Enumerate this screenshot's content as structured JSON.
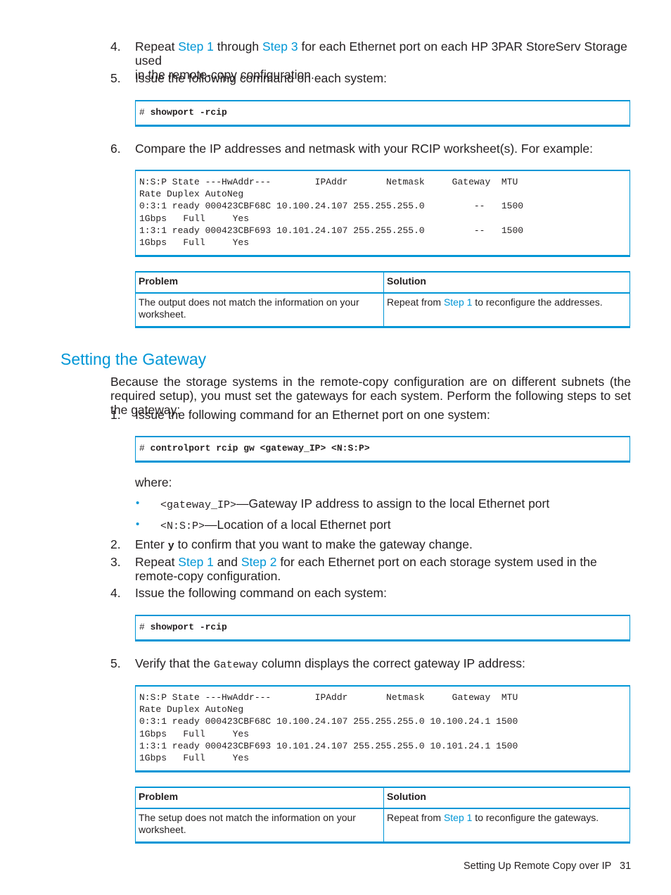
{
  "steps_a": {
    "s4": {
      "num": "4.",
      "t1": "Repeat ",
      "link1": "Step 1",
      "t2": " through ",
      "link2": "Step 3",
      "t3": " for each Ethernet port on each HP 3PAR StoreServ Storage used",
      "line2": "in the remote-copy configuration."
    },
    "s5": {
      "num": "5.",
      "text": "Issue the following command on each system:"
    },
    "cmd1": {
      "prompt": "# ",
      "command": "showport -rcip"
    },
    "s6": {
      "num": "6.",
      "text": "Compare the IP addresses and netmask with your RCIP worksheet(s). For example:"
    },
    "output1": {
      "lines": [
        "N:S:P State ---HwAddr---        IPAddr       Netmask     Gateway  MTU",
        "Rate Duplex AutoNeg",
        "0:3:1 ready 000423CBF68C 10.100.24.107 255.255.255.0         --   1500",
        "1Gbps   Full     Yes",
        "1:3:1 ready 000423CBF693 10.101.24.107 255.255.255.0         --   1500",
        "1Gbps   Full     Yes"
      ]
    },
    "table1": {
      "headers": [
        "Problem",
        "Solution"
      ],
      "problem": "The output does not match the information on your worksheet.",
      "sol_pre": "Repeat from ",
      "sol_link": "Step 1",
      "sol_post": " to reconfigure the addresses."
    }
  },
  "section": {
    "title": "Setting the Gateway",
    "intro": "Because the storage systems in the remote-copy configuration are on different subnets (the required setup), you must set the gateways for each system. Perform the following steps to set the gateway:",
    "s1": {
      "num": "1.",
      "text": "Issue the following command for an Ethernet port on one system:"
    },
    "cmd2": {
      "prompt": "# ",
      "command": "controlport rcip gw <gateway_IP> <N:S:P>"
    },
    "where": "where:",
    "bullets": [
      {
        "code": "<gateway_IP>",
        "text": "—Gateway IP address to assign to the local Ethernet port"
      },
      {
        "code": "<N:S:P>",
        "text": "—Location of a local Ethernet port"
      }
    ],
    "bullet_glyph": "•",
    "s2": {
      "num": "2.",
      "t1": "Enter ",
      "code": "y",
      "t2": " to confirm that you want to make the gateway change."
    },
    "s3": {
      "num": "3.",
      "t1": "Repeat ",
      "link1": "Step 1",
      "t2": " and ",
      "link2": "Step 2",
      "t3": " for each Ethernet port on each storage system used in the",
      "line2": "remote-copy configuration."
    },
    "s4": {
      "num": "4.",
      "text": "Issue the following command on each system:"
    },
    "cmd3": {
      "prompt": "# ",
      "command": "showport -rcip"
    },
    "s5": {
      "num": "5.",
      "t1": "Verify that the ",
      "code": "Gateway",
      "t2": " column displays the correct gateway IP address:"
    },
    "output2": {
      "lines": [
        "N:S:P State ---HwAddr---        IPAddr       Netmask     Gateway  MTU",
        "Rate Duplex AutoNeg",
        "0:3:1 ready 000423CBF68C 10.100.24.107 255.255.255.0 10.100.24.1 1500",
        "1Gbps   Full     Yes",
        "1:3:1 ready 000423CBF693 10.101.24.107 255.255.255.0 10.101.24.1 1500",
        "1Gbps   Full     Yes"
      ]
    },
    "table2": {
      "headers": [
        "Problem",
        "Solution"
      ],
      "problem": "The setup does not match the information on your worksheet.",
      "sol_pre": "Repeat from ",
      "sol_link": "Step 1",
      "sol_post": " to reconfigure the gateways."
    }
  },
  "footer": {
    "chapter": "Setting Up Remote Copy over IP",
    "page": "31"
  },
  "colors": {
    "accent": "#0096d6",
    "text": "#231f20"
  }
}
